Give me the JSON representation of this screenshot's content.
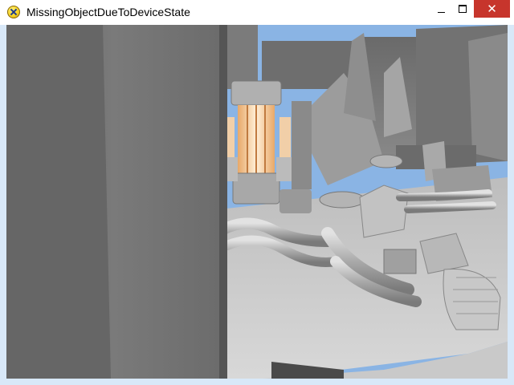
{
  "window": {
    "title": "MissingObjectDueToDeviceState",
    "app_icon": "directx-sample-icon",
    "controls": {
      "minimize": "minimize-icon",
      "maximize": "maximize-icon",
      "close": "close-icon"
    },
    "close_color": "#c7352c"
  },
  "scene": {
    "sky_color": "#8ab4e4",
    "glow_color": "#f8c58a"
  }
}
